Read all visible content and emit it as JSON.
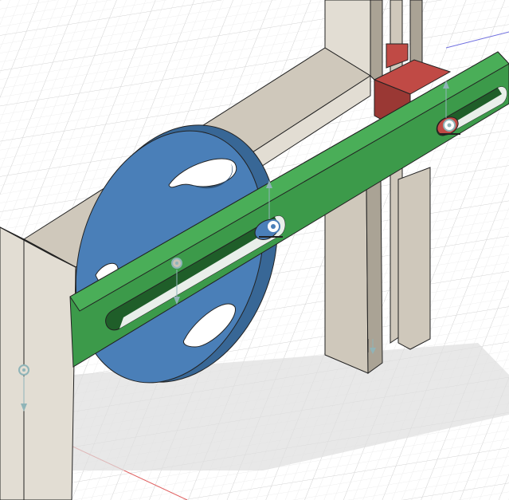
{
  "viewport": {
    "background": "#ffffff",
    "grid_major": "#d4d4d4",
    "grid_minor": "#ececec",
    "shadow": "#dedede"
  },
  "bodies": [
    {
      "name": "base-frame",
      "color": "#cfc8bb",
      "side_color": "#aaa395",
      "face_color": "#e2ddd3"
    },
    {
      "name": "blue-disc",
      "color": "#4a7fb8",
      "side_color": "#386796",
      "slot_color": "#2d4f73"
    },
    {
      "name": "green-arm",
      "color": "#3c9a4a",
      "side_color": "#2c7a37",
      "slot_color": "#1f5e29"
    },
    {
      "name": "red-block",
      "color": "#c04a45",
      "side_color": "#9a3834"
    },
    {
      "name": "slider-rails",
      "color": "#cfc8bb",
      "side_color": "#aaa395"
    }
  ],
  "joints": [
    {
      "name": "pin-joint-blue",
      "color": "#4a7fb8"
    },
    {
      "name": "pin-joint-red",
      "color": "#c04a45"
    },
    {
      "name": "joint-disc-center",
      "color": "#c8c2b6"
    },
    {
      "name": "joint-frame-left",
      "color": "#8fb4b8"
    }
  ],
  "axes": {
    "x_color": "#e06060",
    "y_color": "#7070e0"
  }
}
